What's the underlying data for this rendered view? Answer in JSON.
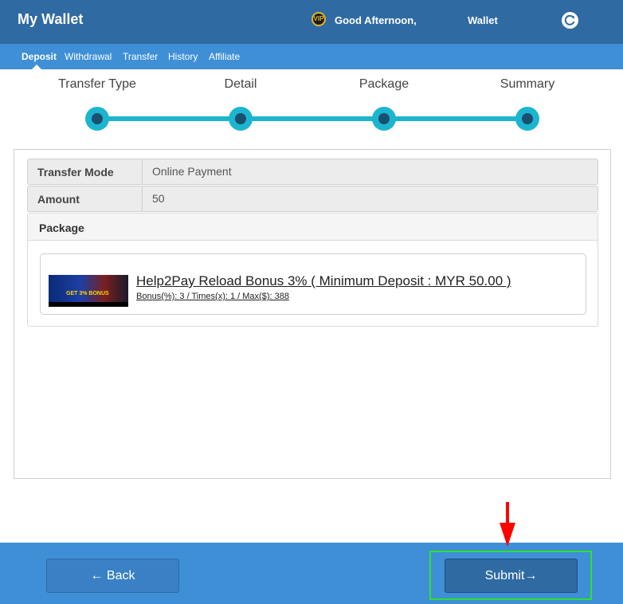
{
  "header": {
    "title": "My Wallet",
    "vip_badge": "VIP",
    "greeting": "Good Afternoon,",
    "wallet_label": "Wallet",
    "icons": {
      "vip": "vip-icon",
      "refresh": "refresh-icon"
    }
  },
  "nav": {
    "items": [
      {
        "label": "Deposit",
        "active": true
      },
      {
        "label": "Withdrawal"
      },
      {
        "label": "Transfer"
      },
      {
        "label": "History"
      },
      {
        "label": "Affiliate"
      }
    ]
  },
  "steps": [
    {
      "label": "Transfer Type"
    },
    {
      "label": "Detail"
    },
    {
      "label": "Package"
    },
    {
      "label": "Summary"
    }
  ],
  "summary": {
    "transfer_mode_label": "Transfer Mode",
    "transfer_mode_value": "Online Payment",
    "amount_label": "Amount",
    "amount_value": "50",
    "package_label": "Package"
  },
  "package": {
    "banner_text": "GET 3% BONUS",
    "title": "Help2Pay Reload Bonus 3% ( Minimum Deposit : MYR 50.00 )",
    "details": "Bonus(%): 3 / Times(x): 1 / Max($): 388"
  },
  "footer": {
    "back_label": "← Back",
    "submit_label": "Submit→"
  },
  "colors": {
    "header_bg": "#2f6aa3",
    "nav_bg": "#3f8fd6",
    "step_accent": "#1cb5d0",
    "highlight": "#2ee02e",
    "pointer_arrow": "#ff0000"
  }
}
